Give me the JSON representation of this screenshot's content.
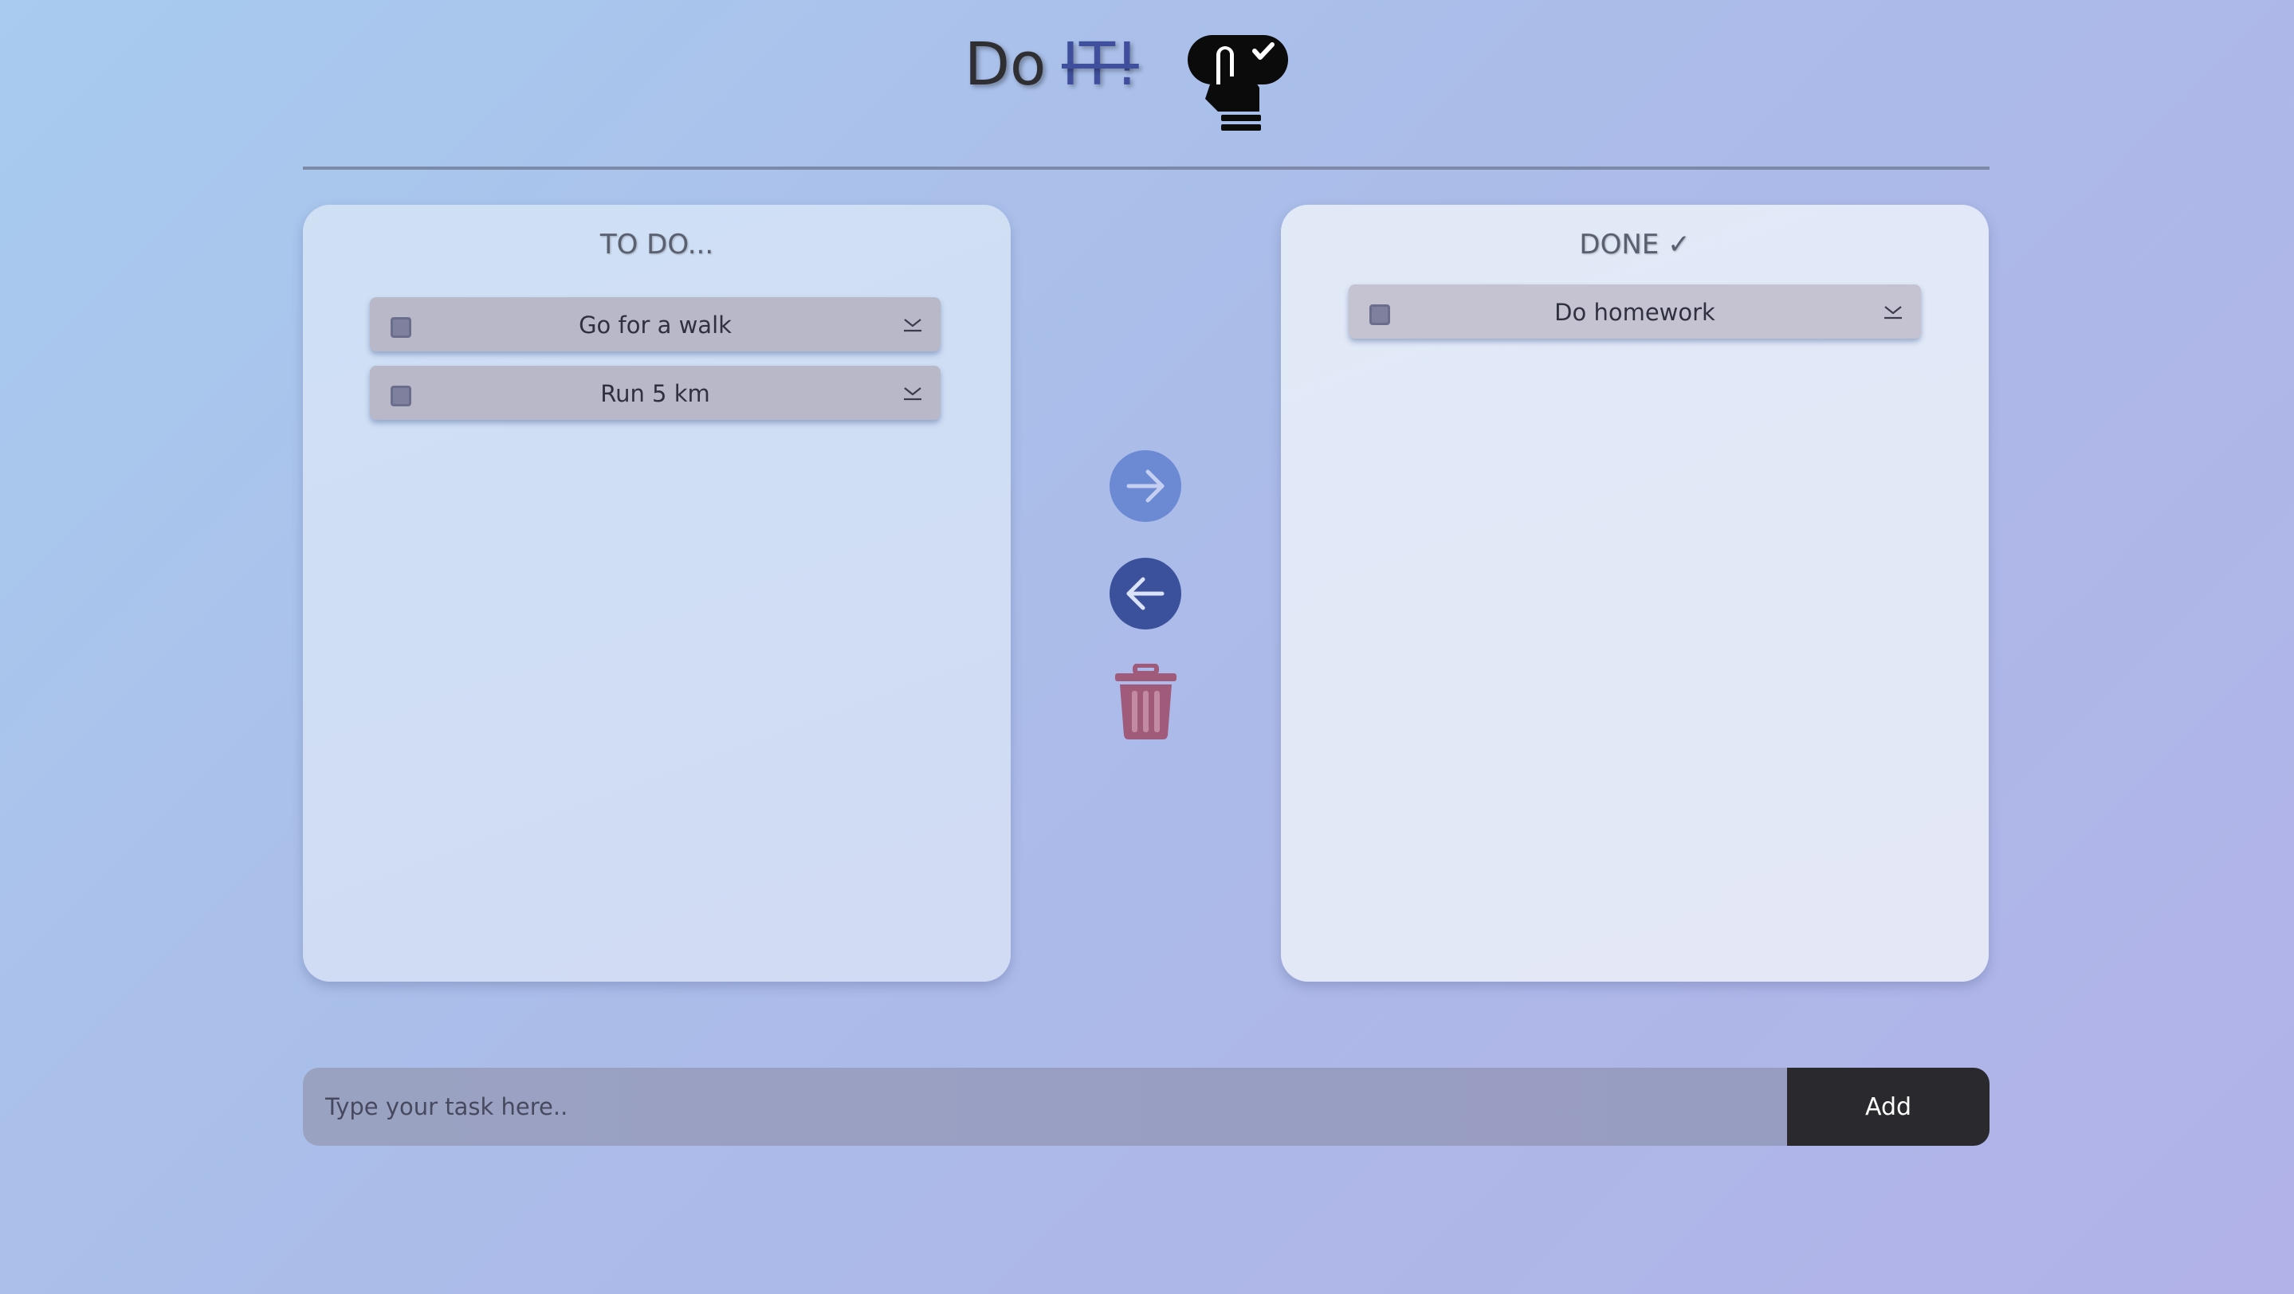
{
  "header": {
    "title_do": "Do",
    "title_it": "IT!",
    "logo_icon": "hand-pointing-check-icon"
  },
  "todo": {
    "title": "TO DO...",
    "tasks": [
      {
        "label": "Go for a walk",
        "checked": false
      },
      {
        "label": "Run 5 km",
        "checked": false
      }
    ]
  },
  "done": {
    "title": "DONE ✓",
    "tasks": [
      {
        "label": "Do homework",
        "checked": false
      }
    ]
  },
  "controls": {
    "move_right_icon": "arrow-right-icon",
    "move_left_icon": "arrow-left-icon",
    "delete_icon": "trash-icon"
  },
  "input": {
    "placeholder": "Type your task here..",
    "value": ""
  },
  "add_button": {
    "label": "Add"
  },
  "colors": {
    "accent_dark": "#3b519b",
    "accent_light": "#6b8ad3",
    "delete": "#a05a7a",
    "button_dark": "#2a2a2e"
  }
}
